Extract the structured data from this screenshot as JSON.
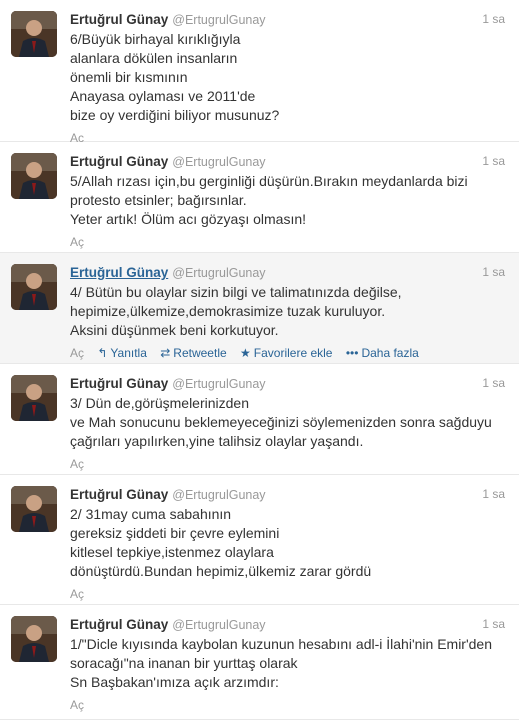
{
  "accent_color": "#2a6496",
  "tweets": [
    {
      "fullname": "Ertuğrul Günay",
      "username": "@ErtugrulGunay",
      "time": "1 sa",
      "text": "6/Büyük birhayal kırıklığıyla\nalanlara dökülen insanların\nönemli bir kısmının\nAnayasa oylaması ve 2011'de\nbize oy verdiğini biliyor musunuz?",
      "expand": "Aç"
    },
    {
      "fullname": "Ertuğrul Günay",
      "username": "@ErtugrulGunay",
      "time": "1 sa",
      "text": "5/Allah rızası için,bu gerginliği düşürün.Bırakın meydanlarda bizi\nprotesto etsinler; bağırsınlar.\nYeter artık! Ölüm acı gözyaşı olmasın!",
      "expand": "Aç"
    },
    {
      "fullname": "Ertuğrul Günay",
      "username": "@ErtugrulGunay",
      "time": "1 sa",
      "text": "4/ Bütün bu olaylar sizin bilgi ve talimatınızda değilse,\nhepimize,ülkemize,demokrasimize tuzak kuruluyor.\nAksini düşünmek beni korkutuyor.",
      "expand": "Aç",
      "actions": {
        "reply": "Yanıtla",
        "retweet": "Retweetle",
        "favorite": "Favorilere ekle",
        "more": "Daha fazla"
      }
    },
    {
      "fullname": "Ertuğrul Günay",
      "username": "@ErtugrulGunay",
      "time": "1 sa",
      "text": "3/ Dün de,görüşmelerinizden\nve Mah sonucunu beklemeyeceğinizi söylemenizden sonra sağduyu\nçağrıları yapılırken,yine talihsiz olaylar yaşandı.",
      "expand": "Aç"
    },
    {
      "fullname": "Ertuğrul Günay",
      "username": "@ErtugrulGunay",
      "time": "1 sa",
      "text": "2/ 31may cuma sabahının\ngereksiz şiddeti bir çevre eylemini\nkitlesel tepkiye,istenmez olaylara\ndönüştürdü.Bundan hepimiz,ülkemiz zarar gördü",
      "expand": "Aç"
    },
    {
      "fullname": "Ertuğrul Günay",
      "username": "@ErtugrulGunay",
      "time": "1 sa",
      "text": "1/\"Dicle kıyısında kaybolan kuzunun hesabını adl-i İlahi'nin Emir'den\nsoracağı\"na inanan bir yurttaş olarak\nSn Başbakan'ımıza açık arzımdır:",
      "expand": "Aç"
    }
  ]
}
